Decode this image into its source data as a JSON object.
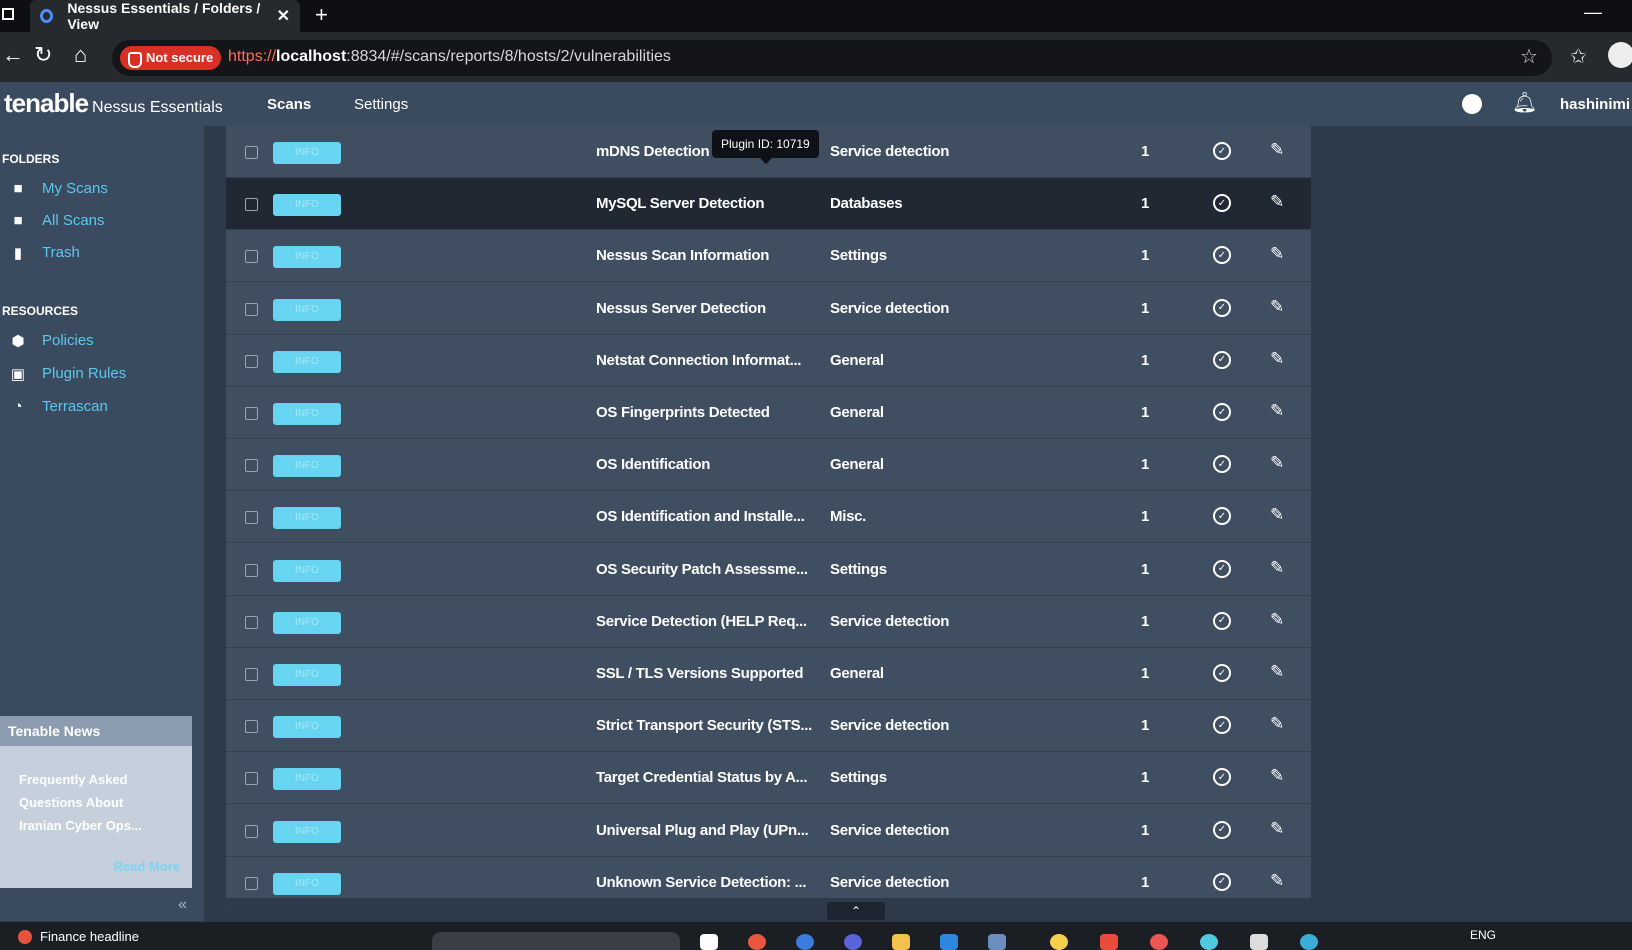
{
  "browser": {
    "tab_title": "Nessus Essentials / Folders / View",
    "tab_close": "✕",
    "new_tab": "+",
    "not_secure": "Not secure",
    "url_proto": "https://",
    "url_host": "localhost",
    "url_rest": ":8834/#/scans/reports/8/hosts/2/vulnerabilities"
  },
  "app": {
    "logo": "tenable",
    "product": "Nessus Essentials",
    "nav": [
      "Scans",
      "Settings"
    ],
    "user": "hashinimi"
  },
  "sidebar": {
    "folders_title": "FOLDERS",
    "folders": [
      {
        "label": "My Scans",
        "icon": "folder-icon"
      },
      {
        "label": "All Scans",
        "icon": "folder-icon"
      },
      {
        "label": "Trash",
        "icon": "trash-icon"
      }
    ],
    "resources_title": "RESOURCES",
    "resources": [
      {
        "label": "Policies",
        "icon": "shield-icon"
      },
      {
        "label": "Plugin Rules",
        "icon": "rules-icon"
      },
      {
        "label": "Terrascan",
        "icon": "terrascan-icon"
      }
    ],
    "news": {
      "title": "Tenable News",
      "lines": [
        "Frequently Asked",
        "Questions About",
        "Iranian Cyber Ops..."
      ],
      "read_more": "Read More"
    },
    "collapse": "«"
  },
  "tooltip": "Plugin ID: 10719",
  "rows": [
    {
      "severity": "INFO",
      "name": "mDNS Detection",
      "family": "Service detection",
      "count": "1"
    },
    {
      "severity": "INFO",
      "name": "MySQL Server Detection",
      "family": "Databases",
      "count": "1"
    },
    {
      "severity": "INFO",
      "name": "Nessus Scan Information",
      "family": "Settings",
      "count": "1"
    },
    {
      "severity": "INFO",
      "name": "Nessus Server Detection",
      "family": "Service detection",
      "count": "1"
    },
    {
      "severity": "INFO",
      "name": "Netstat Connection Informat...",
      "family": "General",
      "count": "1"
    },
    {
      "severity": "INFO",
      "name": "OS Fingerprints Detected",
      "family": "General",
      "count": "1"
    },
    {
      "severity": "INFO",
      "name": "OS Identification",
      "family": "General",
      "count": "1"
    },
    {
      "severity": "INFO",
      "name": "OS Identification and Installe...",
      "family": "Misc.",
      "count": "1"
    },
    {
      "severity": "INFO",
      "name": "OS Security Patch Assessme...",
      "family": "Settings",
      "count": "1"
    },
    {
      "severity": "INFO",
      "name": "Service Detection (HELP Req...",
      "family": "Service detection",
      "count": "1"
    },
    {
      "severity": "INFO",
      "name": "SSL / TLS Versions Supported",
      "family": "General",
      "count": "1"
    },
    {
      "severity": "INFO",
      "name": "Strict Transport Security (STS...",
      "family": "Service detection",
      "count": "1"
    },
    {
      "severity": "INFO",
      "name": "Target Credential Status by A...",
      "family": "Settings",
      "count": "1"
    },
    {
      "severity": "INFO",
      "name": "Universal Plug and Play (UPn...",
      "family": "Service detection",
      "count": "1"
    },
    {
      "severity": "INFO",
      "name": "Unknown Service Detection: ...",
      "family": "Service detection",
      "count": "1"
    }
  ],
  "hovered_row": 1,
  "scroll_top": "⌃",
  "taskbar": {
    "news": "Finance headline",
    "lang": "ENG"
  }
}
